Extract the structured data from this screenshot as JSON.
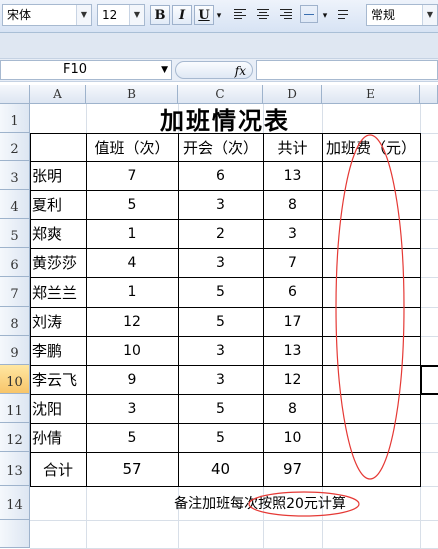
{
  "toolbar": {
    "font_name": "宋体",
    "font_size": "12",
    "bold": "B",
    "italic": "I",
    "underline": "U",
    "number_format": "常规"
  },
  "formula_bar": {
    "name_box": "F10",
    "fx": "fx",
    "content": ""
  },
  "columns": [
    "A",
    "B",
    "C",
    "D",
    "E"
  ],
  "row_numbers": [
    "1",
    "2",
    "3",
    "4",
    "5",
    "6",
    "7",
    "8",
    "9",
    "10",
    "11",
    "12",
    "13",
    "14"
  ],
  "sheet": {
    "title": "加班情况表",
    "headers": [
      "值班（次）",
      "开会（次）",
      "共计",
      "加班费（元）"
    ],
    "rows": [
      {
        "name": "张明",
        "duty": "7",
        "meeting": "6",
        "total": "13"
      },
      {
        "name": "夏利",
        "duty": "5",
        "meeting": "3",
        "total": "8"
      },
      {
        "name": "郑爽",
        "duty": "1",
        "meeting": "2",
        "total": "3"
      },
      {
        "name": "黄莎莎",
        "duty": "4",
        "meeting": "3",
        "total": "7"
      },
      {
        "name": "郑兰兰",
        "duty": "1",
        "meeting": "5",
        "total": "6"
      },
      {
        "name": "刘涛",
        "duty": "12",
        "meeting": "5",
        "total": "17"
      },
      {
        "name": "李鹏",
        "duty": "10",
        "meeting": "3",
        "total": "13"
      },
      {
        "name": "李云飞",
        "duty": "9",
        "meeting": "3",
        "total": "12"
      },
      {
        "name": "沈阳",
        "duty": "3",
        "meeting": "5",
        "total": "8"
      },
      {
        "name": "孙倩",
        "duty": "5",
        "meeting": "5",
        "total": "10"
      }
    ],
    "total_row": {
      "label": "合计",
      "duty": "57",
      "meeting": "40",
      "total": "97"
    },
    "note": "备注加班每次按照20元计算"
  },
  "colors": {
    "annotation": "#e53935",
    "selected_row_header": "#f8c56a"
  }
}
